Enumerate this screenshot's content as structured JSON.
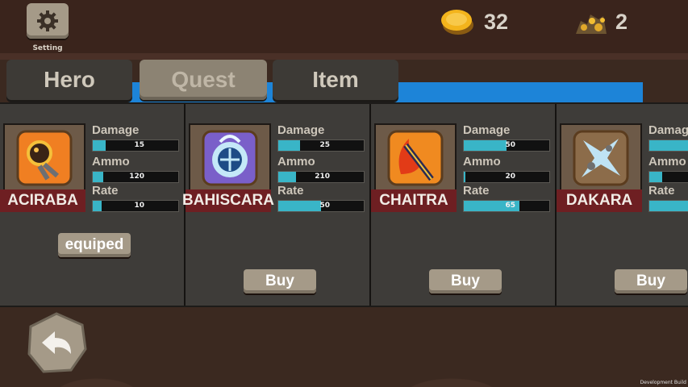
{
  "header": {
    "setting_label": "Setting",
    "coins": "32",
    "gold": "2"
  },
  "tabs": [
    {
      "label": "Hero",
      "active": false
    },
    {
      "label": "Quest",
      "active": true
    },
    {
      "label": "Item",
      "active": false
    }
  ],
  "stat_labels": {
    "damage": "Damage",
    "ammo": "Ammo",
    "rate": "Rate"
  },
  "weapons": [
    {
      "name": "ACIRABA",
      "damage": "15",
      "ammo": "120",
      "rate": "10",
      "damage_fill": 0.15,
      "ammo_fill": 0.12,
      "rate_fill": 0.1,
      "action": "equiped",
      "icon": "fireball-icon"
    },
    {
      "name": "BAHISCARA",
      "damage": "25",
      "ammo": "210",
      "rate": "50",
      "damage_fill": 0.25,
      "ammo_fill": 0.21,
      "rate_fill": 0.5,
      "action": "Buy",
      "icon": "ice-shield-icon"
    },
    {
      "name": "CHAITRA",
      "damage": "50",
      "ammo": "20",
      "rate": "65",
      "damage_fill": 0.5,
      "ammo_fill": 0.02,
      "rate_fill": 0.65,
      "action": "Buy",
      "icon": "flame-staff-icon"
    },
    {
      "name": "DAKARA",
      "damage": "",
      "ammo": "",
      "rate": "",
      "damage_fill": 0.7,
      "ammo_fill": 0.15,
      "rate_fill": 0.5,
      "action": "Buy",
      "icon": "ice-shard-icon"
    }
  ],
  "footer": {
    "dev_build": "Development Build"
  },
  "colors": {
    "accent": "#39b5c7",
    "name_banner": "#6e1f22",
    "tab_strip": "#1d84d8"
  }
}
